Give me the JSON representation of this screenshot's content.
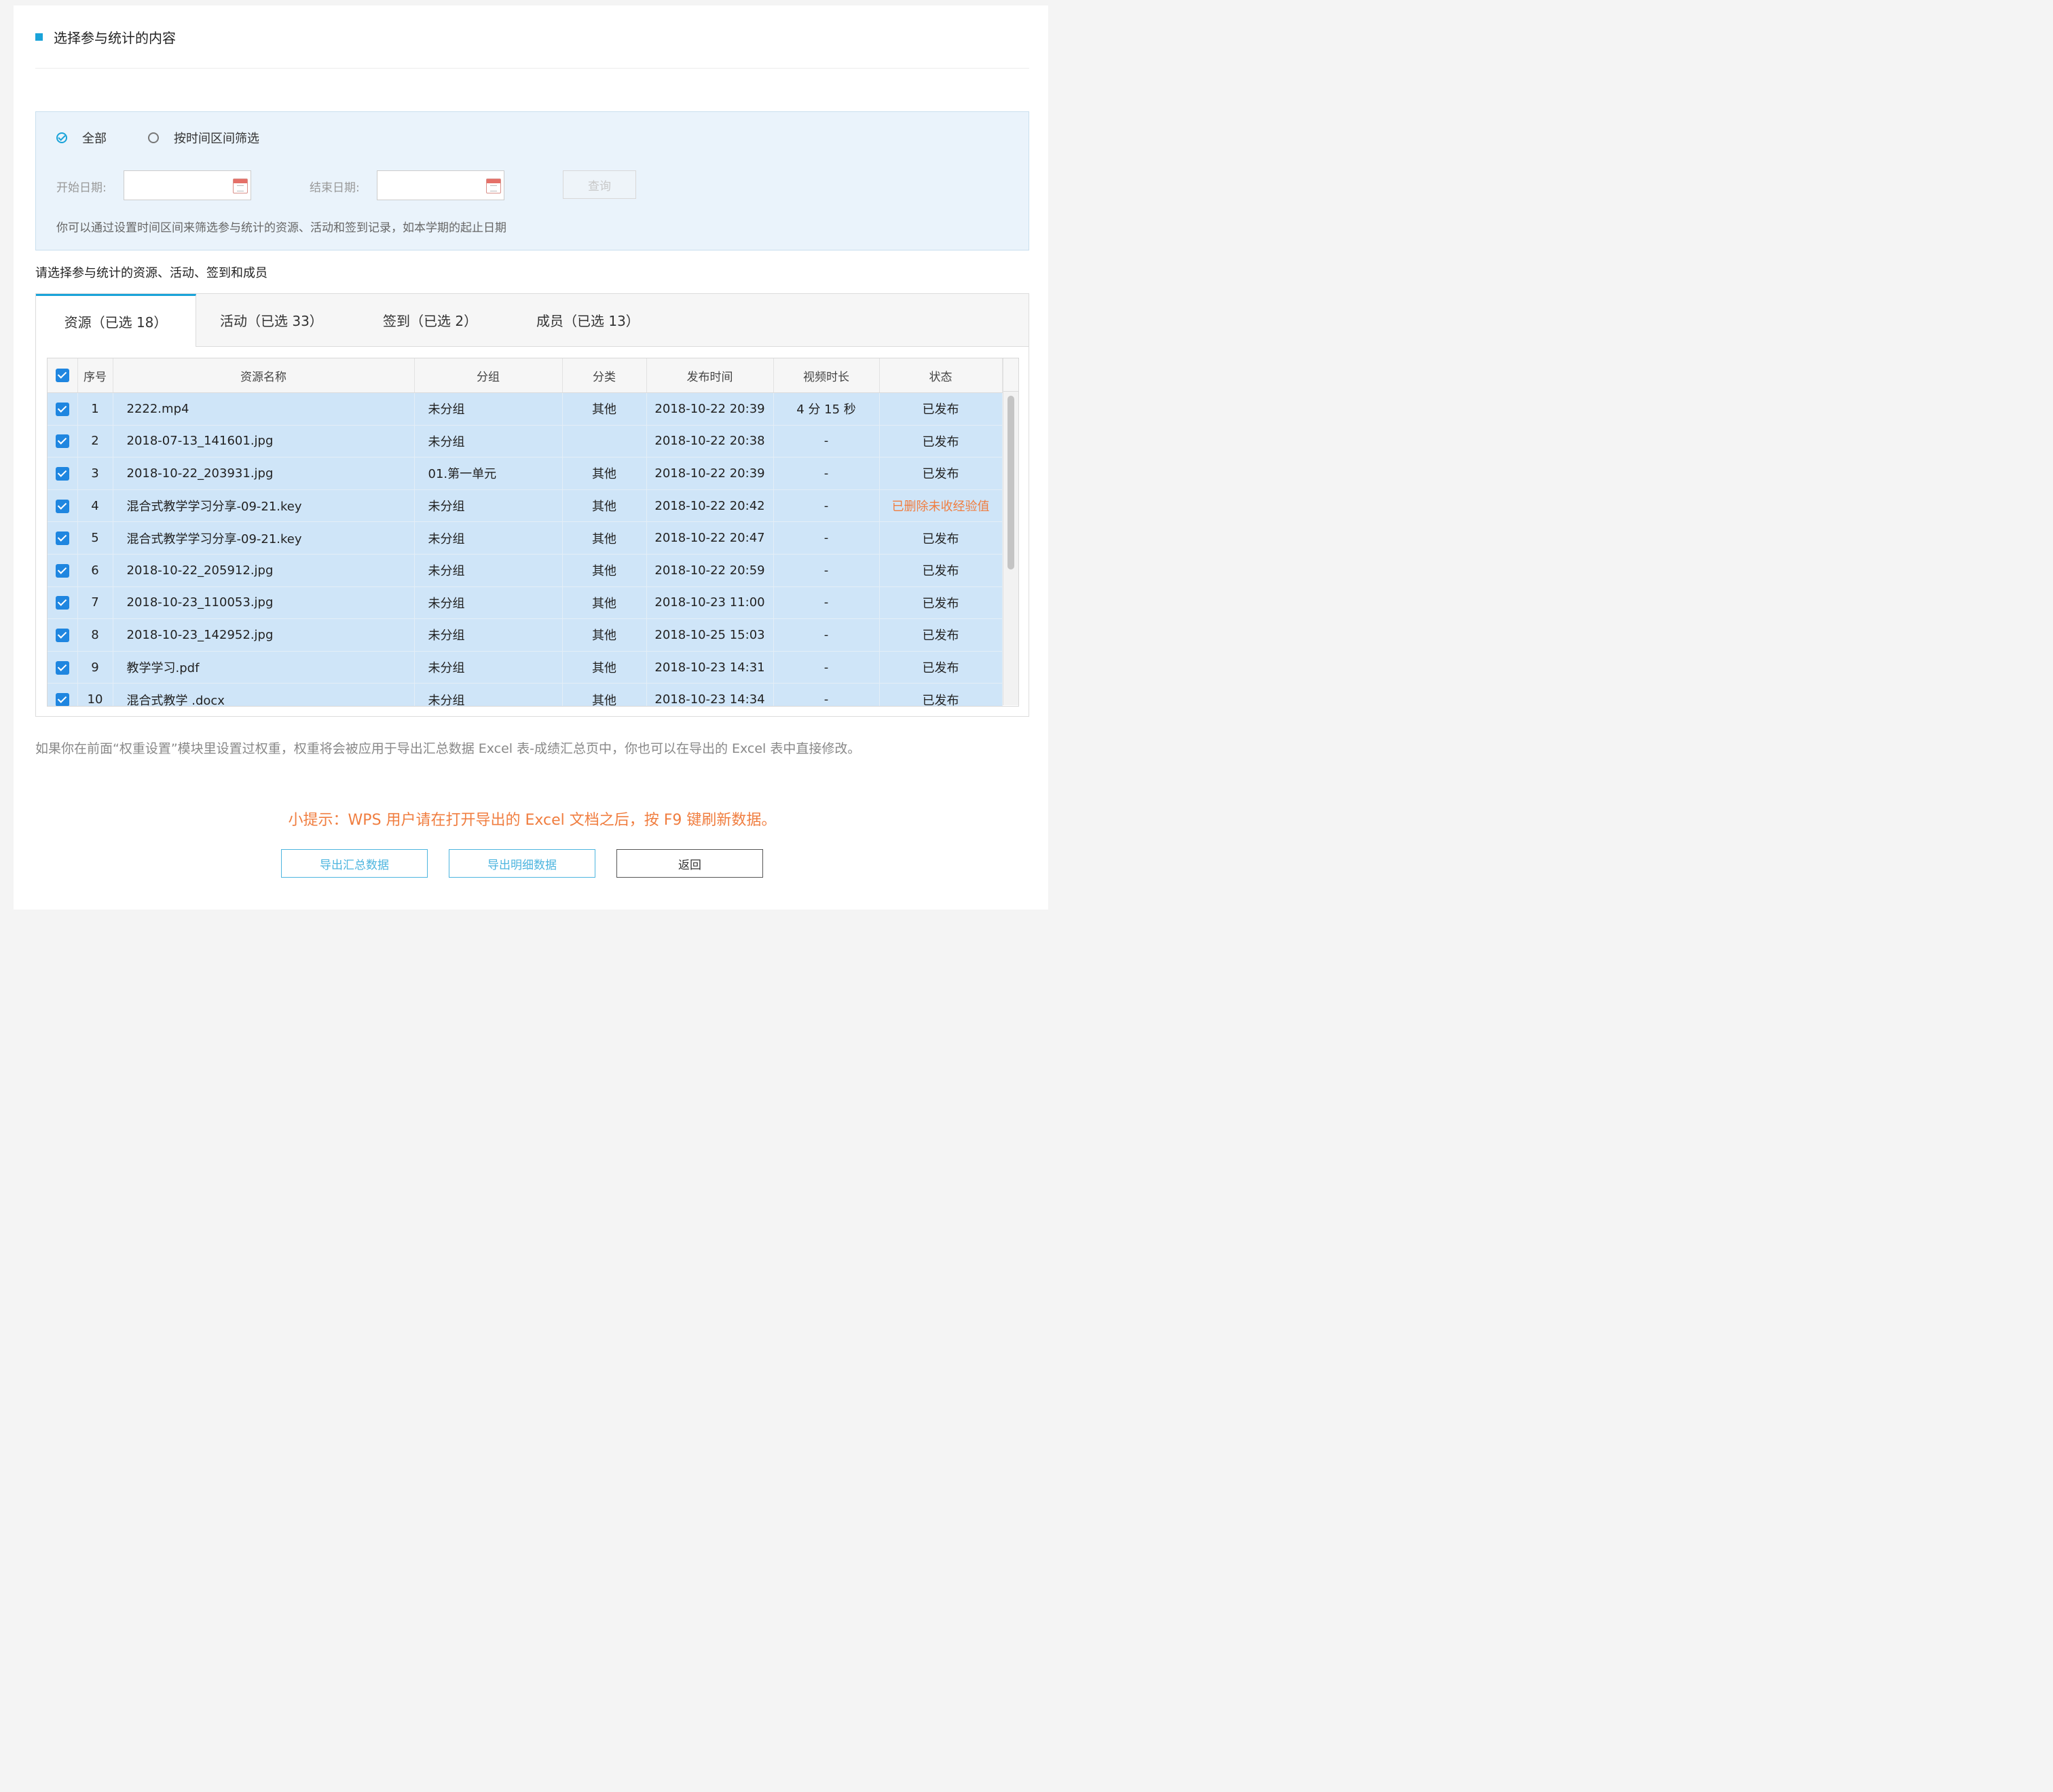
{
  "section_title": "选择参与统计的内容",
  "filter": {
    "radio_all": "全部",
    "radio_range": "按时间区间筛选",
    "start_label": "开始日期:",
    "end_label": "结束日期:",
    "query_button": "查询",
    "hint": "你可以通过设置时间区间来筛选参与统计的资源、活动和签到记录，如本学期的起止日期"
  },
  "subtitle": "请选择参与统计的资源、活动、签到和成员",
  "tabs": [
    {
      "label": "资源（已选 18）"
    },
    {
      "label": "活动（已选 33）"
    },
    {
      "label": "签到（已选 2）"
    },
    {
      "label": "成员（已选 13）"
    }
  ],
  "table": {
    "headers": [
      "序号",
      "资源名称",
      "分组",
      "分类",
      "发布时间",
      "视频时长",
      "状态"
    ],
    "rows": [
      {
        "no": "1",
        "name": "2222.mp4",
        "group": "未分组",
        "category": "其他",
        "time": "2018-10-22 20:39",
        "duration": "4 分 15 秒",
        "status": "已发布"
      },
      {
        "no": "2",
        "name": "2018-07-13_141601.jpg",
        "group": "未分组",
        "category": "",
        "time": "2018-10-22 20:38",
        "duration": "-",
        "status": "已发布"
      },
      {
        "no": "3",
        "name": "2018-10-22_203931.jpg",
        "group": "01.第一单元",
        "category": "其他",
        "time": "2018-10-22 20:39",
        "duration": "-",
        "status": "已发布"
      },
      {
        "no": "4",
        "name": "混合式教学学习分享-09-21.key",
        "group": "未分组",
        "category": "其他",
        "time": "2018-10-22 20:42",
        "duration": "-",
        "status": "已删除未收经验值"
      },
      {
        "no": "5",
        "name": "混合式教学学习分享-09-21.key",
        "group": "未分组",
        "category": "其他",
        "time": "2018-10-22 20:47",
        "duration": "-",
        "status": "已发布"
      },
      {
        "no": "6",
        "name": "2018-10-22_205912.jpg",
        "group": "未分组",
        "category": "其他",
        "time": "2018-10-22 20:59",
        "duration": "-",
        "status": "已发布"
      },
      {
        "no": "7",
        "name": "2018-10-23_110053.jpg",
        "group": "未分组",
        "category": "其他",
        "time": "2018-10-23 11:00",
        "duration": "-",
        "status": "已发布"
      },
      {
        "no": "8",
        "name": "2018-10-23_142952.jpg",
        "group": "未分组",
        "category": "其他",
        "time": "2018-10-25 15:03",
        "duration": "-",
        "status": "已发布"
      },
      {
        "no": "9",
        "name": "教学学习.pdf",
        "group": "未分组",
        "category": "其他",
        "time": "2018-10-23 14:31",
        "duration": "-",
        "status": "已发布"
      },
      {
        "no": "10",
        "name": "混合式教学 .docx",
        "group": "未分组",
        "category": "其他",
        "time": "2018-10-23 14:34",
        "duration": "-",
        "status": "已发布"
      }
    ]
  },
  "note": "如果你在前面“权重设置”模块里设置过权重，权重将会被应用于导出汇总数据 Excel 表-成绩汇总页中，你也可以在导出的 Excel 表中直接修改。",
  "tip": "小提示：WPS 用户请在打开导出的 Excel 文档之后，按 F9 键刷新数据。",
  "buttons": {
    "export_summary": "导出汇总数据",
    "export_detail": "导出明细数据",
    "back": "返回"
  },
  "colors": {
    "accent": "#1aa3d9",
    "row_selected": "#cfe5f8",
    "warning": "#f07d3f"
  }
}
